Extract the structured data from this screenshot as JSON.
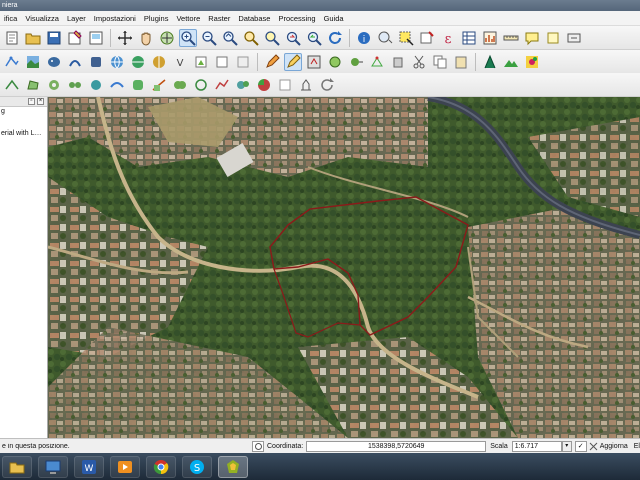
{
  "window": {
    "title_fragment": "niera"
  },
  "menus": [
    "ifica",
    "Visualizza",
    "Layer",
    "Impostazioni",
    "Plugins",
    "Vettore",
    "Raster",
    "Database",
    "Processing",
    "Guida"
  ],
  "toolbars": {
    "row1": [
      "new-project",
      "open-project",
      "save-project",
      "save-as",
      "print-composer",
      "pan",
      "pan-to-selection",
      "zoom-in",
      "zoom-out",
      "zoom-full",
      "zoom-to-layer",
      "zoom-to-selection",
      "zoom-last",
      "zoom-next",
      "refresh",
      "identify",
      "pan-dropdown",
      "select-features",
      "deselect",
      "field-calculator",
      "attribute-table",
      "statistics",
      "measure",
      "annotation",
      "text-annotation",
      "label-tool"
    ],
    "row2": [
      "add-vector",
      "add-raster",
      "add-postgis",
      "add-spatialite",
      "add-mssql",
      "add-wms",
      "add-wcs",
      "add-wfs",
      "add-delimited",
      "new-shapefile",
      "new-spatialite",
      "new-gpx",
      "edit-pencil",
      "toggle-editing",
      "save-edits",
      "add-feature",
      "move-feature",
      "node-tool",
      "delete-selected",
      "cut",
      "copy",
      "paste",
      "undo",
      "gps",
      "raster-tool",
      "terrain",
      "plugin-tool"
    ],
    "row3": [
      "digitize-1",
      "digitize-2",
      "digitize-3",
      "digitize-4",
      "digitize-5",
      "digitize-6",
      "digitize-7",
      "digitize-8",
      "digitize-9",
      "digitize-10",
      "digitize-11",
      "digitize-12",
      "digitize-13",
      "digitize-14",
      "digitize-15",
      "rotate"
    ]
  },
  "layers_panel": {
    "header_item": "g",
    "items": [
      "erial with L…"
    ]
  },
  "status": {
    "message": "e in questa posizione.",
    "coord_label": "Coordinata:",
    "coord_value": "1538398,5720649",
    "scale_label": "Scala",
    "scale_value": "1:6.717",
    "refresh_label": "Aggiorna",
    "overflow": "El"
  },
  "map": {
    "boundary_color": "#8b1a1a"
  },
  "taskbar": [
    "file-explorer",
    "remote-desktop",
    "word",
    "media-player",
    "chrome",
    "skype",
    "qgis"
  ]
}
